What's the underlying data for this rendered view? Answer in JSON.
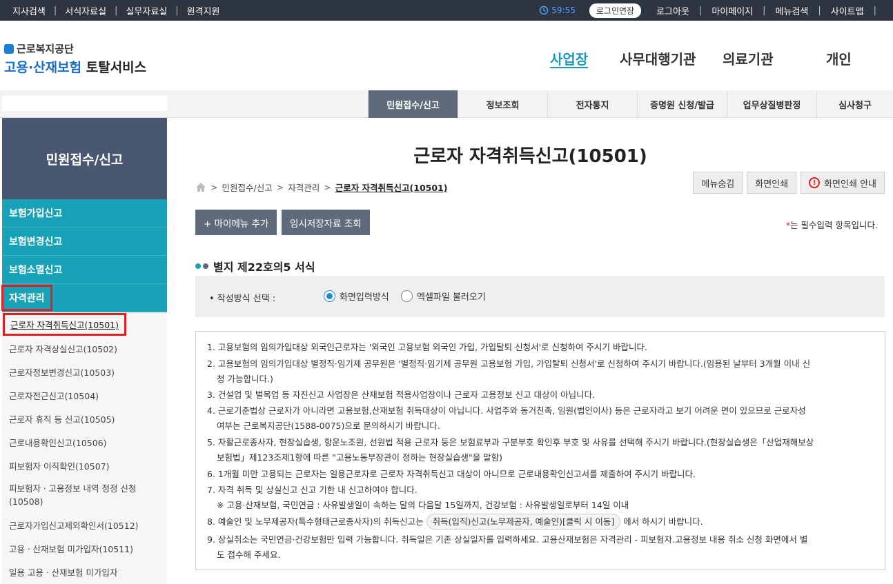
{
  "topbar": {
    "left_links": [
      "지사검색",
      "서식자료실",
      "실무자료실",
      "원격지원"
    ],
    "timer": "59:55",
    "extend_button": "로그인연장",
    "right_links": [
      "로그아웃",
      "마이페이지",
      "메뉴검색",
      "사이트맵"
    ]
  },
  "logo": {
    "org": "근로복지공단",
    "service_blue": "고용·산재보험",
    "service_dark": "토탈서비스"
  },
  "main_nav": [
    "사업장",
    "사무대행기관",
    "의료기관",
    "개인"
  ],
  "sub_nav": [
    "민원접수/신고",
    "정보조회",
    "전자통지",
    "증명원 신청/발급",
    "업무상질병판정",
    "심사청구"
  ],
  "sidebar": {
    "title": "민원접수/신고",
    "groups": [
      "보험가입신고",
      "보험변경신고",
      "보험소멸신고",
      "자격관리"
    ],
    "items": [
      "근로자 자격취득신고(10501)",
      "근로자 자격상실신고(10502)",
      "근로자정보변경신고(10503)",
      "근로자전근신고(10504)",
      "근로자 휴직 등 신고(10505)",
      "근로내용확인신고(10506)",
      "피보험자 이직확인(10507)",
      "피보험자ㆍ고용정보 내역 정정 신청",
      "(10508)",
      "근로자가입신고제외확인서(10512)",
      "고용ㆍ산재보험 미가입자(10511)",
      "일용 고용ㆍ산재보험 미가입자"
    ]
  },
  "page": {
    "title": "근로자 자격취득신고(10501)",
    "breadcrumb": [
      "민원접수/신고",
      "자격관리",
      "근로자 자격취득신고(10501)"
    ],
    "buttons": {
      "hide_menu": "메뉴숨김",
      "print": "화면인쇄",
      "print_guide": "화면인쇄 안내",
      "add_mymenu": "+ 마이메뉴 추가",
      "temp_saved": "임시저장자료 조회"
    },
    "required_note_star": "*",
    "required_note": "는 필수입력 항목입니다.",
    "section_title": "별지 제22호의5 서식",
    "form": {
      "label": "• 작성방식 선택 :",
      "option1": "화면입력방식",
      "option2": "엑셀파일 불러오기",
      "selected": "option1"
    },
    "notice_lines": [
      "1. 고용보험의 임의가입대상 외국인근로자는 '외국인 고용보험 외국인 가입, 가입탈퇴 신청서'로 신청하여 주시기 바랍니다.",
      "2. 고용보험의 임의가입대상 별정직·임기제 공무원은 '별정직·임기제 공무원 고용보험 가입, 가입탈퇴 신청서'로 신청하여 주시기 바랍니다.(임용된 날부터 3개월 이내 신",
      "청 가능합니다.)",
      "3. 건설업 및 벌목업 등 자진신고 사업장은 산재보험 적용사업장이나 근로자 고용정보 신고 대상이 아닙니다.",
      "4. 근로기준법상 근로자가 아니라면 고용보험,산재보험 취득대상이 아닙니다. 사업주와 동거친족, 임원(법인이사) 등은 근로자라고 보기 어려운 면이 있으므로 근로자성",
      "여부는 근로복지공단(1588-0075)으로 문의하시기 바랍니다.",
      "5. 자활근로종사자, 현장실습생, 항운노조원, 선원법 적용 근로자 등은 보험료부과 구분부호 확인후 부호 및 사유를 선택해 주시기 바랍니다.(현장실습생은「산업재해보상",
      "보험법」제123조제1항에 따른 \"고용노동부장관이 정하는 현장실습생\"을 말함)",
      "6. 1개월 미만 고용되는 근로자는 일용근로자로 근로자 자격취득신고 대상이 아니므로 근로내용확인신고서를 제출하여 주시기 바랍니다.",
      "7. 자격 취득 및 상실신고 신고 기한 내 신고하여야 합니다.",
      "※ 고용·산재보험, 국민연금 : 사유발생일이 속하는 달의 다음달 15일까지, 건강보험 : 사유발생일로부터 14일 이내",
      "8. 예술인 및 노무제공자(특수형태근로종사자)의 취득신고는",
      "취득(입직)신고(노무제공자, 예술인)[클릭 시 이동]",
      "에서 하시기 바랍니다.",
      "9. 상실취소는 국민연금·건강보험만 입력 가능합니다. 취득일은 기존 상실일자를 입력하세요. 고용산재보험은 자격관리 - 피보험자.고용정보 내용 취소 신청 화면에서 별",
      "도 접수해 주세요."
    ]
  }
}
